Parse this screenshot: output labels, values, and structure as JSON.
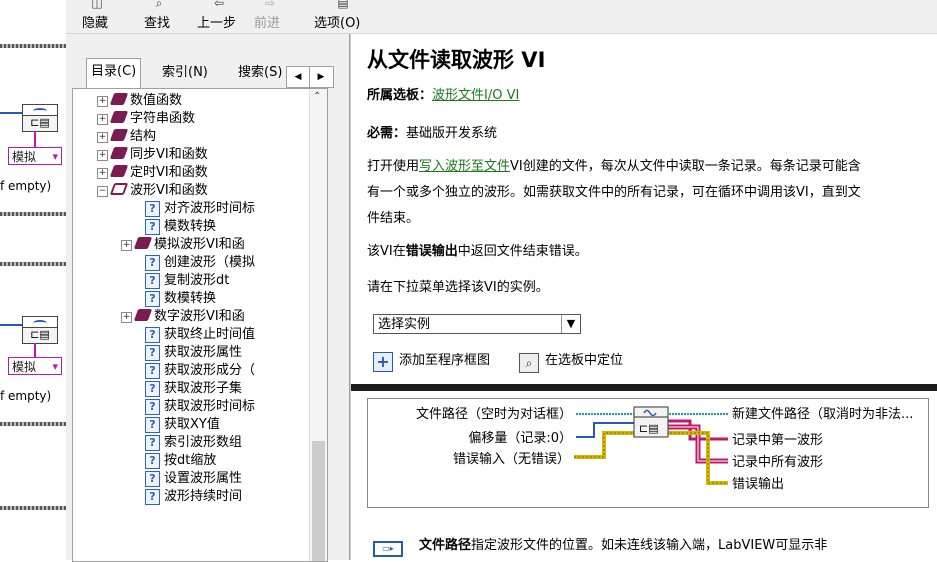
{
  "toolbar": {
    "hide": "隐藏",
    "find": "查找",
    "back": "上一步",
    "forward": "前进",
    "options": "选项(O)"
  },
  "left_bg": {
    "sel1": "模拟",
    "sel2": "模拟",
    "text1": "f empty)",
    "text2": "f empty)"
  },
  "nav": {
    "tabs": [
      "目录(C)",
      "索引(N)",
      "搜索(S)"
    ],
    "scroll_left": "◀",
    "scroll_right": "▶"
  },
  "tree": [
    {
      "type": "book",
      "expander": "+",
      "label": "数值函数"
    },
    {
      "type": "book",
      "expander": "+",
      "label": "字符串函数"
    },
    {
      "type": "book",
      "expander": "+",
      "label": "结构"
    },
    {
      "type": "book",
      "expander": "+",
      "label": "同步VI和函数"
    },
    {
      "type": "book",
      "expander": "+",
      "label": "定时VI和函数"
    },
    {
      "type": "openbook",
      "expander": "−",
      "label": "波形VI和函数"
    },
    {
      "type": "page",
      "label": "对齐波形时间标"
    },
    {
      "type": "page",
      "label": "模数转换"
    },
    {
      "type": "book",
      "expander": "+",
      "label": "模拟波形VI和函"
    },
    {
      "type": "page",
      "label": "创建波形（模拟"
    },
    {
      "type": "page",
      "label": "复制波形dt"
    },
    {
      "type": "page",
      "label": "数模转换"
    },
    {
      "type": "book",
      "expander": "+",
      "label": "数字波形VI和函"
    },
    {
      "type": "page",
      "label": "获取终止时间值"
    },
    {
      "type": "page",
      "label": "获取波形属性"
    },
    {
      "type": "page",
      "label": "获取波形成分（"
    },
    {
      "type": "page",
      "label": "获取波形子集"
    },
    {
      "type": "page",
      "label": "获取波形时间标"
    },
    {
      "type": "page",
      "label": "获取XY值"
    },
    {
      "type": "page",
      "label": "索引波形数组"
    },
    {
      "type": "page",
      "label": "按dt缩放"
    },
    {
      "type": "page",
      "label": "设置波形属性"
    },
    {
      "type": "page",
      "label": "波形持续时间"
    }
  ],
  "content": {
    "title": "从文件读取波形 VI",
    "palette_label": "所属选板：",
    "palette_link": "波形文件I/O VI",
    "requires_label": "必需：",
    "requires_value": "基础版开发系统",
    "para1_prefix": "打开使用",
    "para1_link": "写入波形至文件",
    "para1_line1_rest": "VI创建的文件，每次从文件中读取一条记录。每条记录可能含",
    "para1_line2": "有一个或多个独立的波形。如需获取文件中的所有记录，可在循环中调用该VI，直到文",
    "para1_line3": "件结束。",
    "para2_prefix": "该VI在",
    "para2_bold": "错误输出",
    "para2_suffix": "中返回文件结束错误。",
    "para3": "请在下拉菜单选择该VI的实例。",
    "select_value": "选择实例",
    "add_button": "添加至程序框图",
    "locate_button": "在选板中定位",
    "connector": {
      "in1": "文件路径（空时为对话框）",
      "in2": "偏移量（记录:0）",
      "in3": "错误输入（无错误）",
      "out1": "新建文件路径（取消时为非法...",
      "out2": "记录中第一波形",
      "out3": "记录中所有波形",
      "out4": "错误输出"
    },
    "footer_bold": "文件路径",
    "footer_rest": "指定波形文件的位置。如未连线该输入端，LabVIEW可显示非"
  },
  "colors": {
    "link": "#1a7a1a",
    "wire_blue": "#2a58b8",
    "wire_yellow": "#c9b400",
    "wire_pink": "#c2186b",
    "book": "#7b1c52"
  }
}
